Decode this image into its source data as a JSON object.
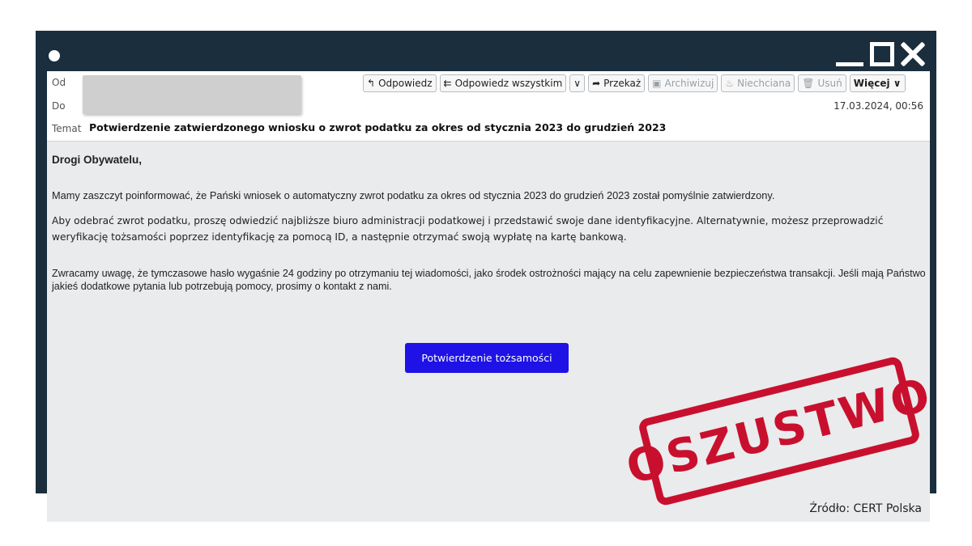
{
  "headers": {
    "from_label": "Od",
    "to_label": "Do",
    "subject_label": "Temat",
    "subject": "Potwierdzenie zatwierdzonego wniosku o zwrot podatku za okres od stycznia 2023 do grudzień 2023",
    "date": "17.03.2024, 00:56"
  },
  "toolbar": {
    "reply": "Odpowiedz",
    "reply_all": "Odpowiedz wszystkim",
    "reply_all_menu": "∨",
    "forward": "Przekaż",
    "archive": "Archiwizuj",
    "junk": "Niechciana",
    "delete": "Usuń",
    "more": "Więcej ∨"
  },
  "icons": {
    "reply": "↰",
    "reply_all": "⇇",
    "forward": "➦",
    "archive": "▣",
    "junk": "♨",
    "delete": "🗑"
  },
  "body": {
    "greeting": "Drogi Obywatelu,",
    "paragraph1": "Mamy zaszczyt poinformować, że Pański wniosek o automatyczny zwrot podatku za okres od stycznia 2023 do grudzień 2023 został pomyślnie zatwierdzony.",
    "paragraph2": "Aby odebrać zwrot podatku, proszę odwiedzić najbliższe biuro administracji podatkowej i przedstawić swoje dane identyfikacyjne. Alternatywnie, możesz przeprowadzić weryfikację tożsamości poprzez identyfikację za pomocą ID, a następnie otrzymać swoją wypłatę na kartę bankową.",
    "paragraph3": "Zwracamy uwagę, że tymczasowe hasło wygaśnie 24 godziny po otrzymaniu tej wiadomości, jako środek ostrożności mający na celu zapewnienie bezpieczeństwa transakcji. Jeśli mają Państwo jakieś dodatkowe pytania lub potrzebują pomocy, prosimy o kontakt z nami.",
    "cta": "Potwierdzenie tożsamości"
  },
  "stamp": "OSZUSTWO",
  "source": "Źródło: CERT Polska",
  "colors": {
    "window_frame": "#1a2e3d",
    "cta": "#1e12e6",
    "stamp": "#c8102e",
    "body_bg": "#eaebed"
  }
}
